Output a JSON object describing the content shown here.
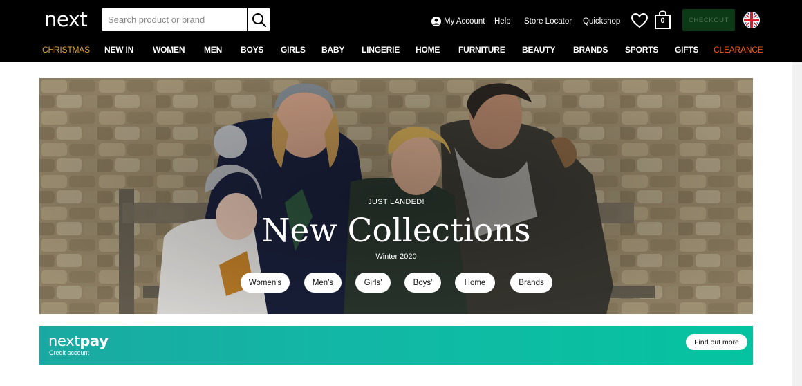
{
  "header": {
    "logo_text": "next",
    "search": {
      "placeholder": "Search product or brand",
      "value": ""
    },
    "utility": {
      "my_account": "My Account",
      "help": "Help",
      "store_locator": "Store Locator",
      "quickshop": "Quickshop"
    },
    "bag_count": "0",
    "checkout_label": "CHECKOUT"
  },
  "nav": {
    "items": [
      "CHRISTMAS",
      "NEW IN",
      "WOMEN",
      "MEN",
      "BOYS",
      "GIRLS",
      "BABY",
      "LINGERIE",
      "HOME",
      "FURNITURE",
      "BEAUTY",
      "BRANDS",
      "SPORTS",
      "GIFTS",
      "CLEARANCE"
    ]
  },
  "hero": {
    "kicker": "JUST LANDED!",
    "title": "New Collections",
    "subtitle": "Winter 2020",
    "buttons": [
      "Women's",
      "Men's",
      "Girls'",
      "Boys'",
      "Home",
      "Brands"
    ]
  },
  "nextpay": {
    "logo_next": "next",
    "logo_pay": "pay",
    "subtitle": "Credit account",
    "button": "Find out more"
  },
  "colors": {
    "header_bg": "#000000",
    "christmas": "#d9a441",
    "clearance": "#f05b1a",
    "checkout_bg": "#0c3a16",
    "nextpay_start": "#1aa9a2",
    "nextpay_end": "#05c3a0"
  },
  "icons": [
    "search-icon",
    "account-icon",
    "heart-icon",
    "bag-icon",
    "uk-flag-icon"
  ]
}
